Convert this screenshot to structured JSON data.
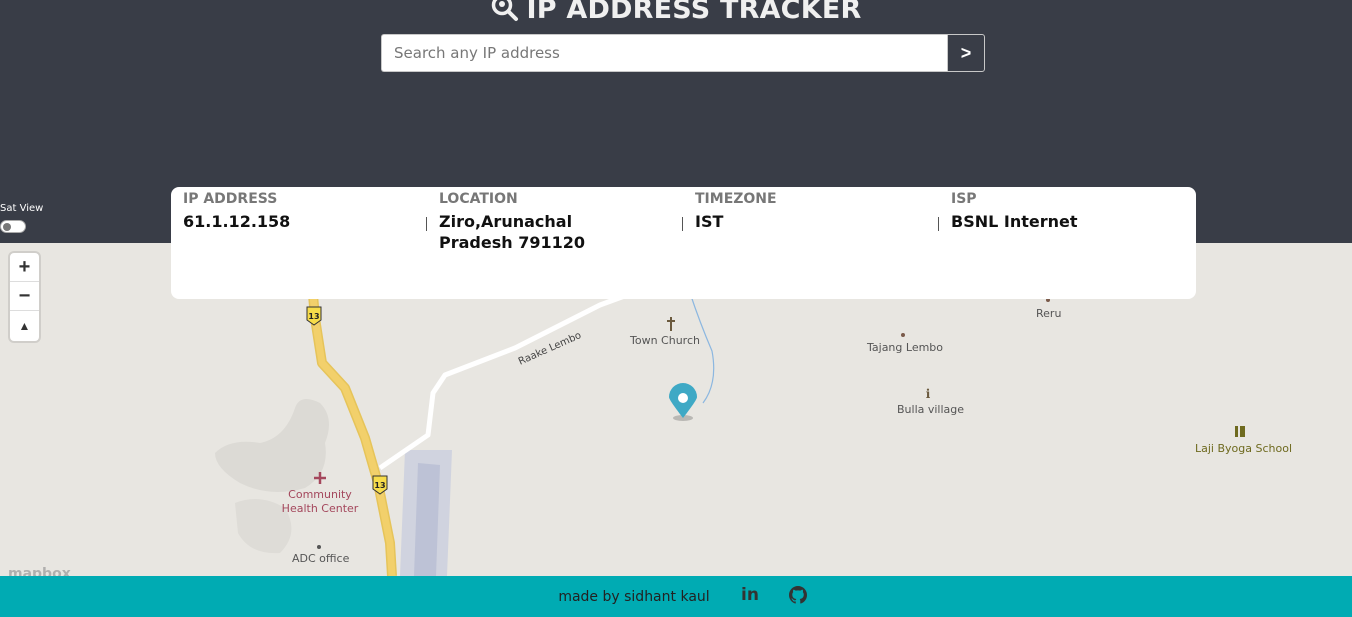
{
  "header": {
    "title": "IP ADDRESS TRACKER",
    "search_placeholder": "Search any IP address",
    "search_button": ">",
    "sat_view_label": "Sat View"
  },
  "info": [
    {
      "label": "IP ADDRESS",
      "value": "61.1.12.158"
    },
    {
      "label": "LOCATION",
      "value": "Ziro,Arunachal Pradesh 791120"
    },
    {
      "label": "TIMEZONE",
      "value": "IST"
    },
    {
      "label": "ISP",
      "value": "BSNL Internet"
    }
  ],
  "map": {
    "zoom_in": "+",
    "zoom_out": "−",
    "compass": "▲",
    "attribution_logo": "mapbox",
    "route_badge": "13",
    "labels": {
      "road": "Raake Lembo",
      "town_church": "Town Church",
      "tajang_lembo": "Tajang Lembo",
      "reru": "Reru",
      "bulla_village": "Bulla village",
      "laji_byoga_school": "Laji Byoga School",
      "community_health_center": "Community Health Center",
      "adc_office": "ADC office"
    },
    "colors": {
      "highway": "#f2d06b",
      "marker": "#3fa9c5",
      "water": "#8cb7e0",
      "airstrip": "#c9cede"
    }
  },
  "footer": {
    "text": "made by sidhant kaul",
    "linkedin_label": "in",
    "github_icon": "github-icon"
  }
}
